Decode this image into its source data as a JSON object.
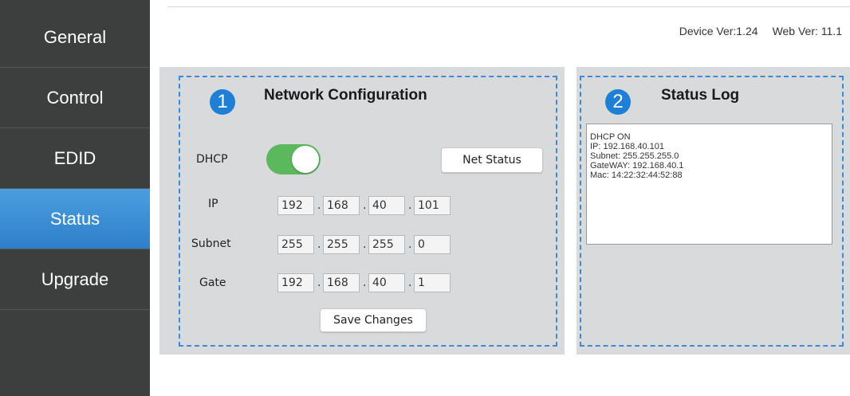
{
  "sidebar": {
    "items": [
      {
        "label": "General",
        "active": false
      },
      {
        "label": "Control",
        "active": false
      },
      {
        "label": "EDID",
        "active": false
      },
      {
        "label": "Status",
        "active": true
      },
      {
        "label": "Upgrade",
        "active": false
      }
    ]
  },
  "header": {
    "device_version": "Device Ver:1.24",
    "web_version": "Web Ver: 11.1"
  },
  "network": {
    "badge": "1",
    "title": "Network Configuration",
    "dhcp_label": "DHCP",
    "dhcp_on": true,
    "net_status_button": "Net Status",
    "ip_label": "IP",
    "ip": [
      "192",
      "168",
      "40",
      "101"
    ],
    "subnet_label": "Subnet",
    "subnet": [
      "255",
      "255",
      "255",
      "0"
    ],
    "gate_label": "Gate",
    "gate": [
      "192",
      "168",
      "40",
      "1"
    ],
    "separator": ".",
    "save_button": "Save Changes"
  },
  "status_log": {
    "badge": "2",
    "title": "Status Log",
    "text": "DHCP ON\nIP: 192.168.40.101\nSubnet: 255.255.255.0\nGateWAY: 192.168.40.1\nMac: 14:22:32:44:52:88"
  },
  "colors": {
    "sidebar": "#3d3f3f",
    "active_item": "#2e7fc9",
    "toggle_on": "#5cb85c",
    "badge": "#1e7fd6",
    "dashed_border": "#3d8ad6",
    "panel": "#d9dadb"
  }
}
